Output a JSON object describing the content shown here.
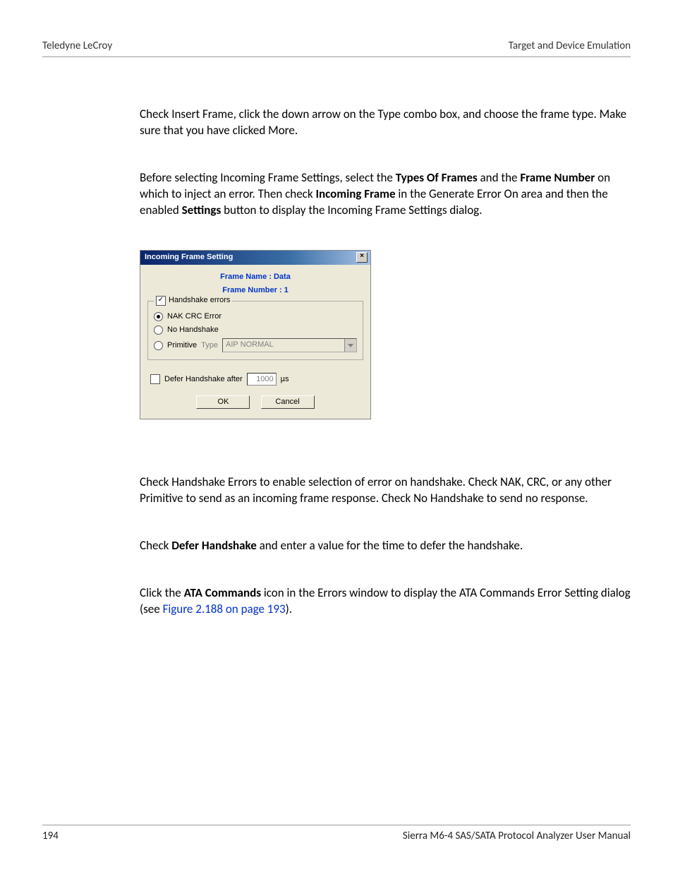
{
  "header": {
    "left": "Teledyne LeCroy",
    "right": "Target and Device Emulation"
  },
  "paragraphs": {
    "p1": "Check Insert Frame, click the down arrow on the Type combo box, and choose the frame type. Make sure that you have clicked More.",
    "p2_a": "Before selecting Incoming Frame Settings, select the ",
    "p2_b1": "Types Of Frames",
    "p2_c": " and the ",
    "p2_b2": "Frame Number",
    "p2_d": " on which to inject an error. Then check ",
    "p2_b3": "Incoming Frame",
    "p2_e": " in the Generate Error On area and then the enabled ",
    "p2_b4": "Settings",
    "p2_f": " button to display the Incoming Frame Settings dialog.",
    "p3": "Check Handshake Errors to enable selection of error on handshake. Check NAK, CRC, or any other Primitive to send as an incoming frame response. Check No Handshake to send no response.",
    "p4_a": "Check ",
    "p4_b": "Defer Handshake",
    "p4_c": " and enter a value for the time to defer the handshake.",
    "p5_a": "Click the ",
    "p5_b": "ATA Commands",
    "p5_c": " icon in the Errors window to display the ATA Commands Error Setting dialog (see ",
    "p5_link": "Figure 2.188 on page 193",
    "p5_d": ")."
  },
  "dialog": {
    "title": "Incoming Frame Setting",
    "close": "×",
    "frame_name_label": "Frame Name : Data",
    "frame_number_label": "Frame Number : 1",
    "handshake_errors_label": "Handshake errors",
    "handshake_check": "✓",
    "nak_label": "NAK CRC Error",
    "nohandshake_label": "No Handshake",
    "primitive_label": "Primitive",
    "type_label": "Type",
    "primitive_combo_value": "AIP NORMAL",
    "defer_label": "Defer Handshake after",
    "defer_value": "1000",
    "defer_unit": "µs",
    "ok": "OK",
    "cancel": "Cancel"
  },
  "footer": {
    "page": "194",
    "manual": "Sierra M6-4 SAS/SATA Protocol Analyzer User Manual"
  }
}
